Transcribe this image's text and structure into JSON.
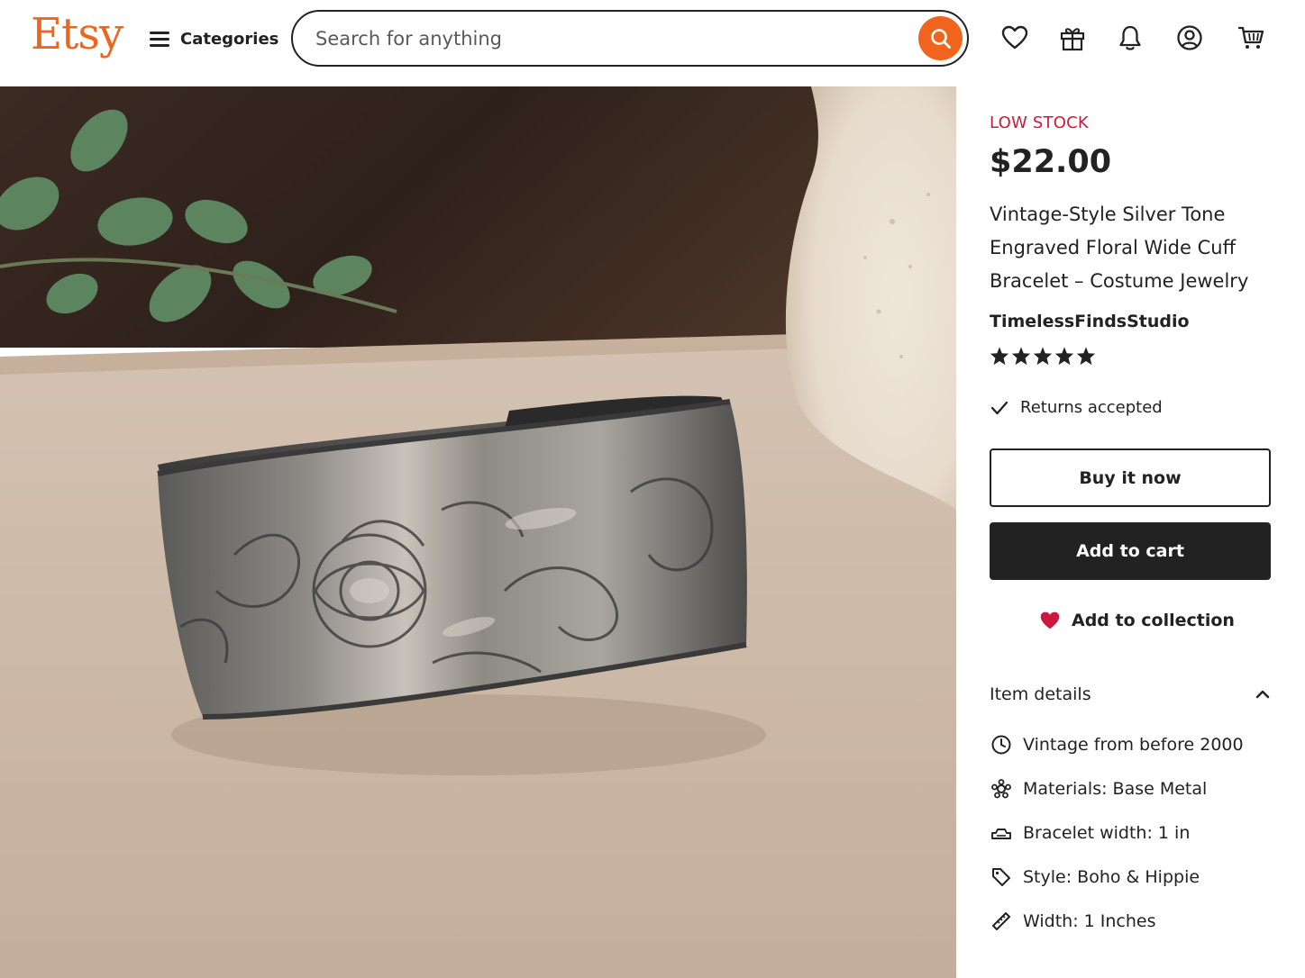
{
  "header": {
    "logo": "Etsy",
    "categories_label": "Categories",
    "search": {
      "placeholder": "Search for anything",
      "value": ""
    },
    "icons": [
      "heart-icon",
      "gift-icon",
      "bell-icon",
      "account-icon",
      "cart-icon"
    ]
  },
  "colors": {
    "brand": "#f1641e",
    "stock": "#c9193e",
    "dark": "#222222",
    "heart": "#c9193e"
  },
  "listing": {
    "stock_label": "LOW STOCK",
    "price": "$22.00",
    "title": "Vintage-Style Silver Tone Engraved Floral Wide Cuff Bracelet – Costume Jewelry",
    "shop_name": "TimelessFindsStudio",
    "rating": 5,
    "rating_max": 5,
    "returns": "Returns accepted",
    "buy_now_label": "Buy it now",
    "add_to_cart_label": "Add to cart",
    "add_to_collection_label": "Add to collection"
  },
  "item_details": {
    "heading": "Item details",
    "expanded": true,
    "rows": [
      {
        "icon": "clock-icon",
        "label": "Vintage",
        "value": "from before 2000"
      },
      {
        "icon": "materials-icon",
        "label": "Materials:",
        "value": "Base Metal"
      },
      {
        "icon": "width-icon",
        "label": "Bracelet width:",
        "value": "1 in"
      },
      {
        "icon": "tag-icon",
        "label": "Style:",
        "value": "Boho & Hippie"
      },
      {
        "icon": "ruler-icon",
        "label": "Width:",
        "value": "1 Inches"
      }
    ]
  }
}
